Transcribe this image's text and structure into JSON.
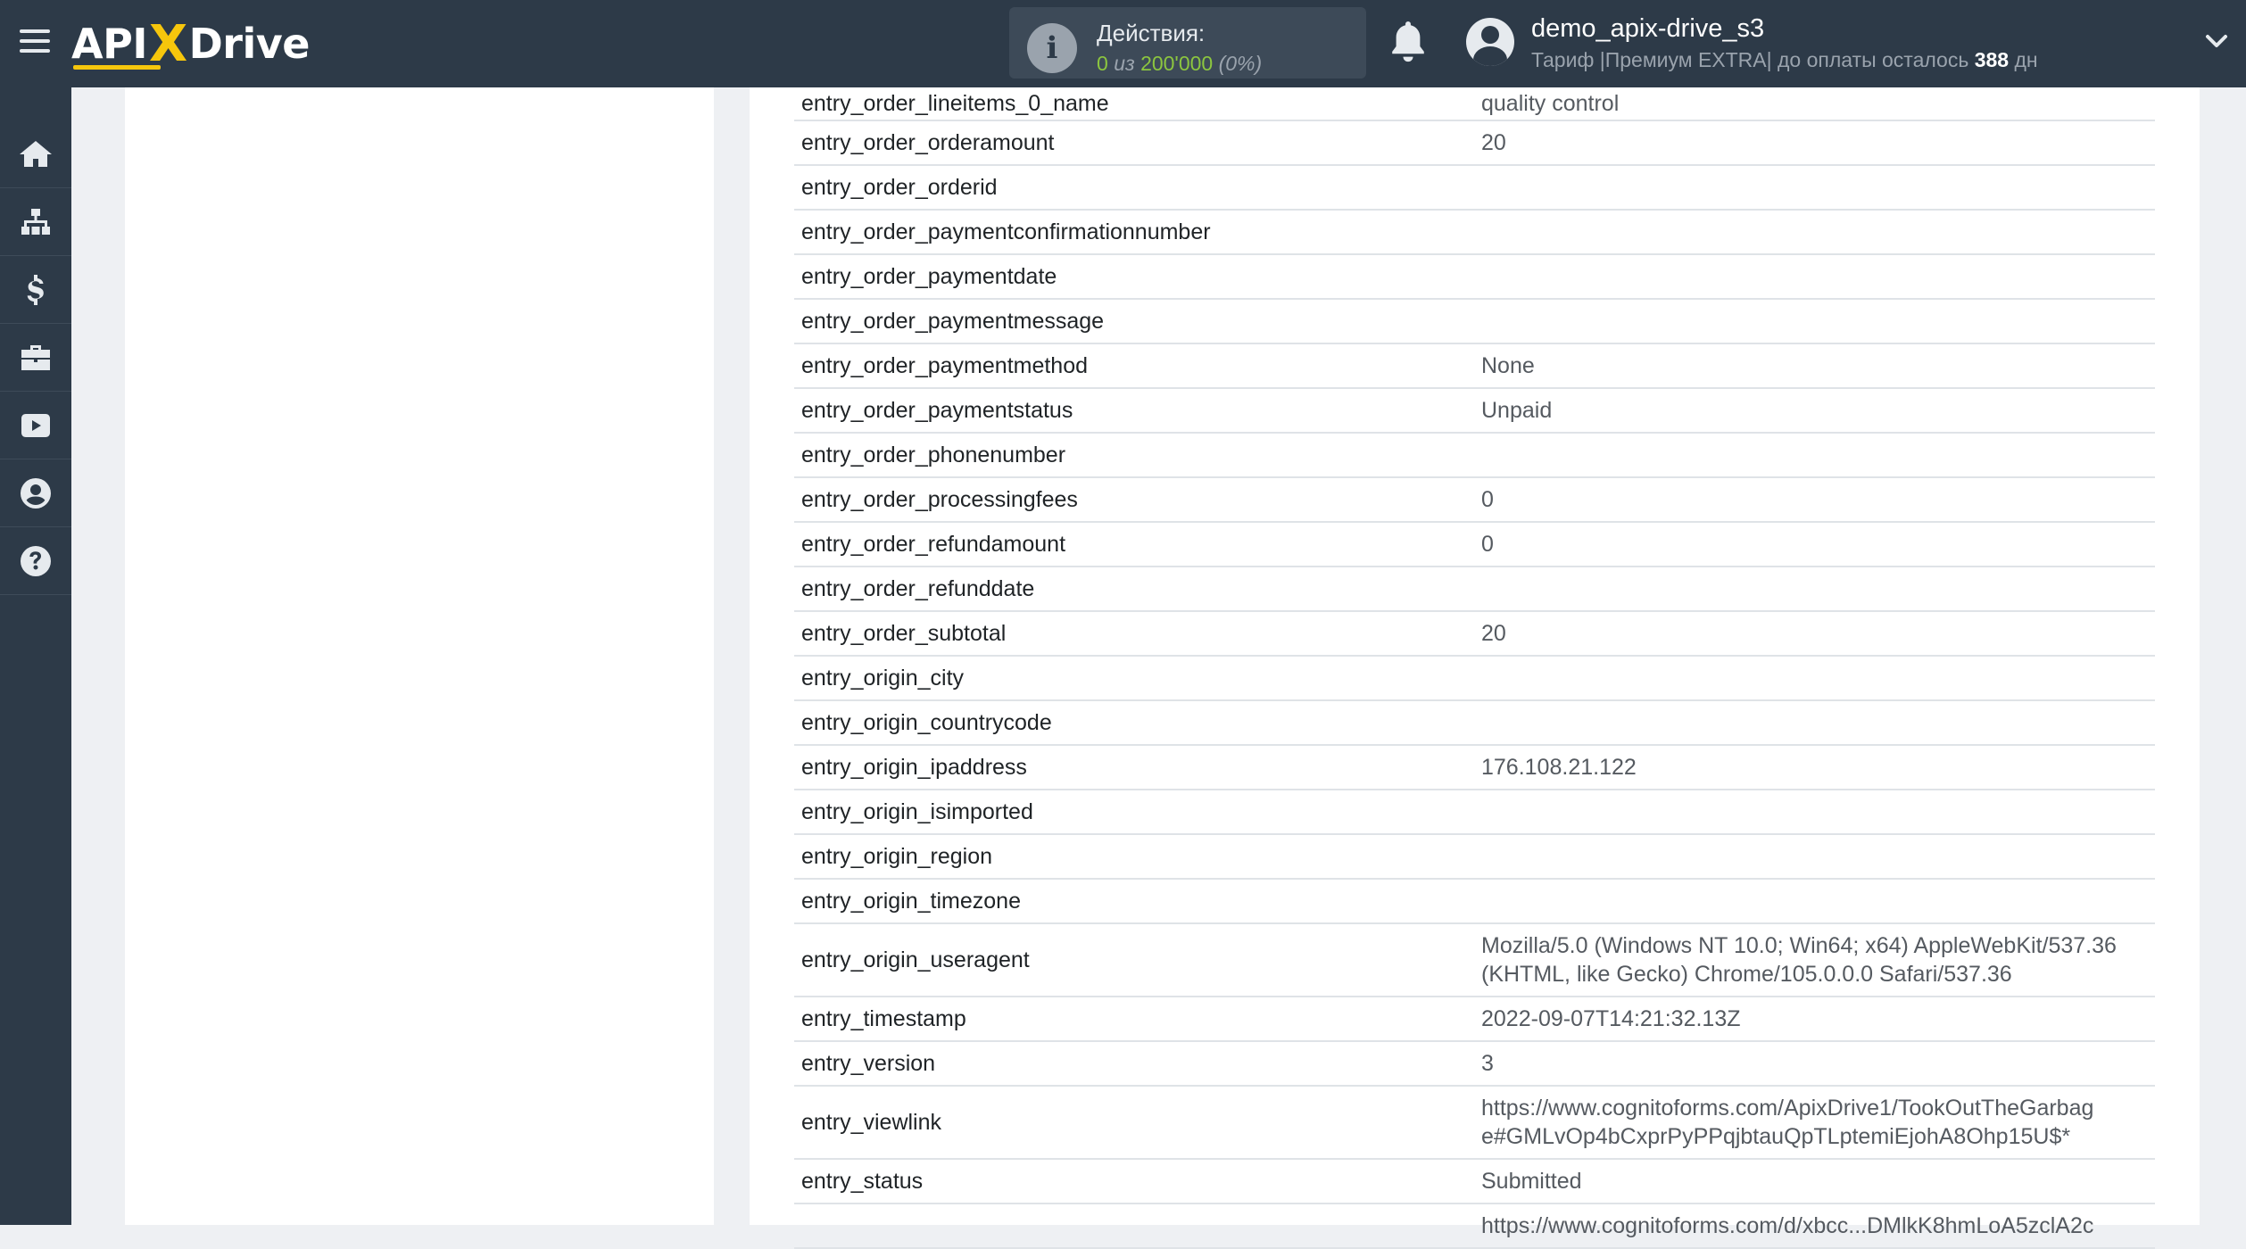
{
  "header": {
    "logo": {
      "left": "API",
      "x": "X",
      "right": "Drive"
    },
    "actions": {
      "title": "Действия:",
      "used": "0",
      "of_label": "из",
      "limit": "200'000",
      "percent": "(0%)"
    },
    "user": {
      "name": "demo_apix-drive_s3",
      "tariff_prefix": "Тариф |Премиум EXTRA| до оплаты осталось",
      "days": "388",
      "days_unit": "дн"
    },
    "icons": [
      "menu-icon",
      "info-icon",
      "bell-icon",
      "user-avatar-icon",
      "chevron-down-icon"
    ]
  },
  "sidebar": {
    "items": [
      {
        "name": "home",
        "icon": "home-icon"
      },
      {
        "name": "connections",
        "icon": "sitemap-icon"
      },
      {
        "name": "billing",
        "icon": "dollar-icon"
      },
      {
        "name": "services",
        "icon": "briefcase-icon"
      },
      {
        "name": "video",
        "icon": "youtube-icon"
      },
      {
        "name": "account",
        "icon": "user-circle-icon"
      },
      {
        "name": "help",
        "icon": "question-icon"
      }
    ]
  },
  "fields": {
    "rows": [
      {
        "key": "entry_order_lineitems_0_name",
        "value": "quality control"
      },
      {
        "key": "entry_order_orderamount",
        "value": "20"
      },
      {
        "key": "entry_order_orderid",
        "value": ""
      },
      {
        "key": "entry_order_paymentconfirmationnumber",
        "value": ""
      },
      {
        "key": "entry_order_paymentdate",
        "value": ""
      },
      {
        "key": "entry_order_paymentmessage",
        "value": ""
      },
      {
        "key": "entry_order_paymentmethod",
        "value": "None"
      },
      {
        "key": "entry_order_paymentstatus",
        "value": "Unpaid"
      },
      {
        "key": "entry_order_phonenumber",
        "value": ""
      },
      {
        "key": "entry_order_processingfees",
        "value": "0"
      },
      {
        "key": "entry_order_refundamount",
        "value": "0"
      },
      {
        "key": "entry_order_refunddate",
        "value": ""
      },
      {
        "key": "entry_order_subtotal",
        "value": "20"
      },
      {
        "key": "entry_origin_city",
        "value": ""
      },
      {
        "key": "entry_origin_countrycode",
        "value": ""
      },
      {
        "key": "entry_origin_ipaddress",
        "value": "176.108.21.122"
      },
      {
        "key": "entry_origin_isimported",
        "value": ""
      },
      {
        "key": "entry_origin_region",
        "value": ""
      },
      {
        "key": "entry_origin_timezone",
        "value": ""
      },
      {
        "key": "entry_origin_useragent",
        "value_lines": [
          "Mozilla/5.0 (Windows NT 10.0; Win64; x64) AppleWebKit/537.36",
          "(KHTML, like Gecko) Chrome/105.0.0.0 Safari/537.36"
        ]
      },
      {
        "key": "entry_timestamp",
        "value": "2022-09-07T14:21:32.13Z"
      },
      {
        "key": "entry_version",
        "value": "3"
      },
      {
        "key": "entry_viewlink",
        "value_lines": [
          "https://www.cognitoforms.com/ApixDrive1/TookOutTheGarbag",
          "e#GMLvOp4bCxprPyPPqjbtauQpTLptemiEjohA8Ohp15U$*"
        ]
      },
      {
        "key": "entry_status",
        "value": "Submitted"
      },
      {
        "key": "",
        "value": "https://www.cognitoforms.com/d/xbcc...DMlkK8hmLoA5zclA2c"
      }
    ]
  }
}
